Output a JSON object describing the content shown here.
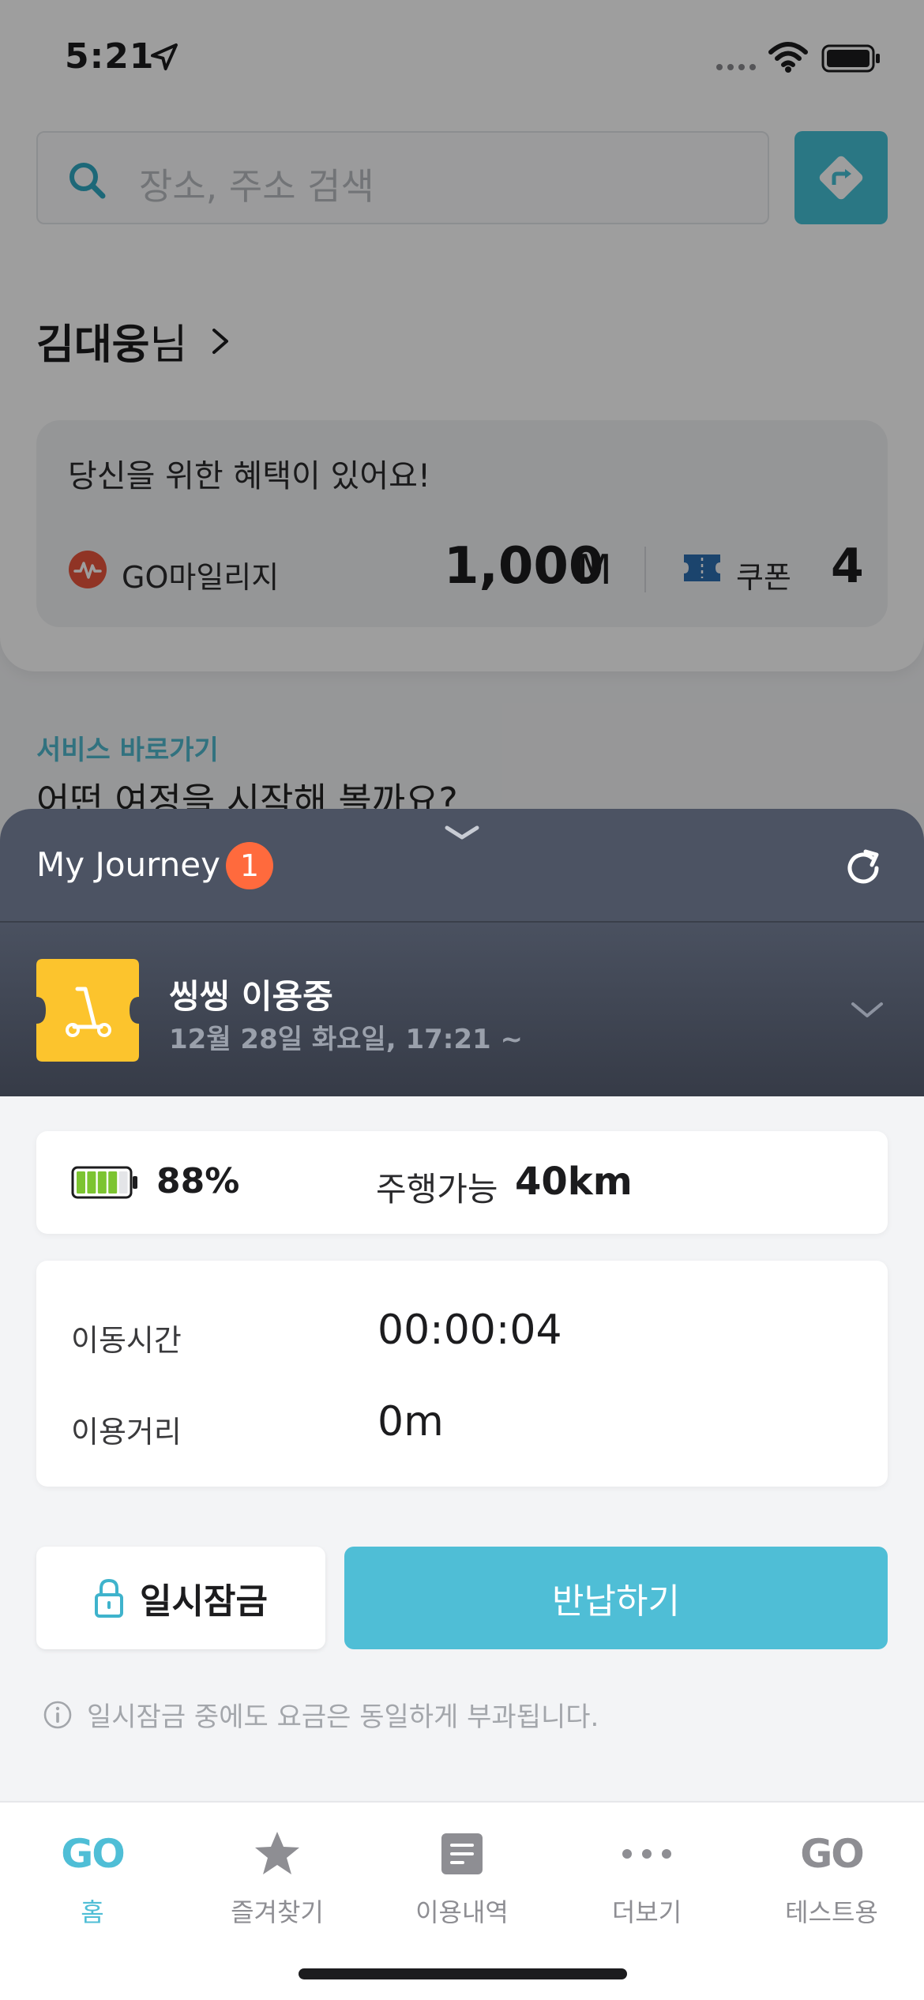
{
  "status_bar": {
    "time": "5:21"
  },
  "search": {
    "placeholder": "장소, 주소 검색"
  },
  "user": {
    "name": "김대웅",
    "suffix": "님"
  },
  "benefit": {
    "title": "당신을 위한 혜택이 있어요!",
    "mileage_label": "GO마일리지",
    "mileage_value": "1,000",
    "mileage_unit": "M",
    "coupon_label": "쿠폰",
    "coupon_count": "4"
  },
  "shortcut": {
    "label": "서비스 바로가기",
    "question": "어떤 여정을 시작해 볼까요?"
  },
  "journey": {
    "title": "My Journey",
    "badge": "1",
    "ride_title": "씽씽 이용중",
    "ride_time": "12월 28일 화요일, 17:21 ~"
  },
  "ride_info": {
    "battery_level": 0.88,
    "battery_percent": "88%",
    "range_label": "주행가능",
    "range_value": "40km",
    "stats": [
      {
        "label": "이동시간",
        "value": "00:00:04"
      },
      {
        "label": "이용거리",
        "value": "0m"
      }
    ]
  },
  "actions": {
    "lock_label": "일시잠금",
    "return_label": "반납하기"
  },
  "notice": "일시잠금 중에도 요금은 동일하게 부과됩니다.",
  "tabs": [
    {
      "label": "홈",
      "icon": "go-logo-icon",
      "glyph": "GO",
      "active": true
    },
    {
      "label": "즐겨찾기",
      "icon": "star-icon",
      "active": false
    },
    {
      "label": "이용내역",
      "icon": "document-icon",
      "active": false
    },
    {
      "label": "더보기",
      "icon": "more-dots-icon",
      "active": false
    },
    {
      "label": "테스트용",
      "icon": "go-logo-icon",
      "glyph": "GO",
      "active": false
    }
  ],
  "colors": {
    "accent": "#4fbed6",
    "sheet_header": "#4c5363",
    "badge": "#ff6a3d",
    "ticket": "#fcc42d",
    "battery_fill": "#7cc431",
    "tab_active": "#4fbed6",
    "tab_inactive": "#8e8e93"
  }
}
